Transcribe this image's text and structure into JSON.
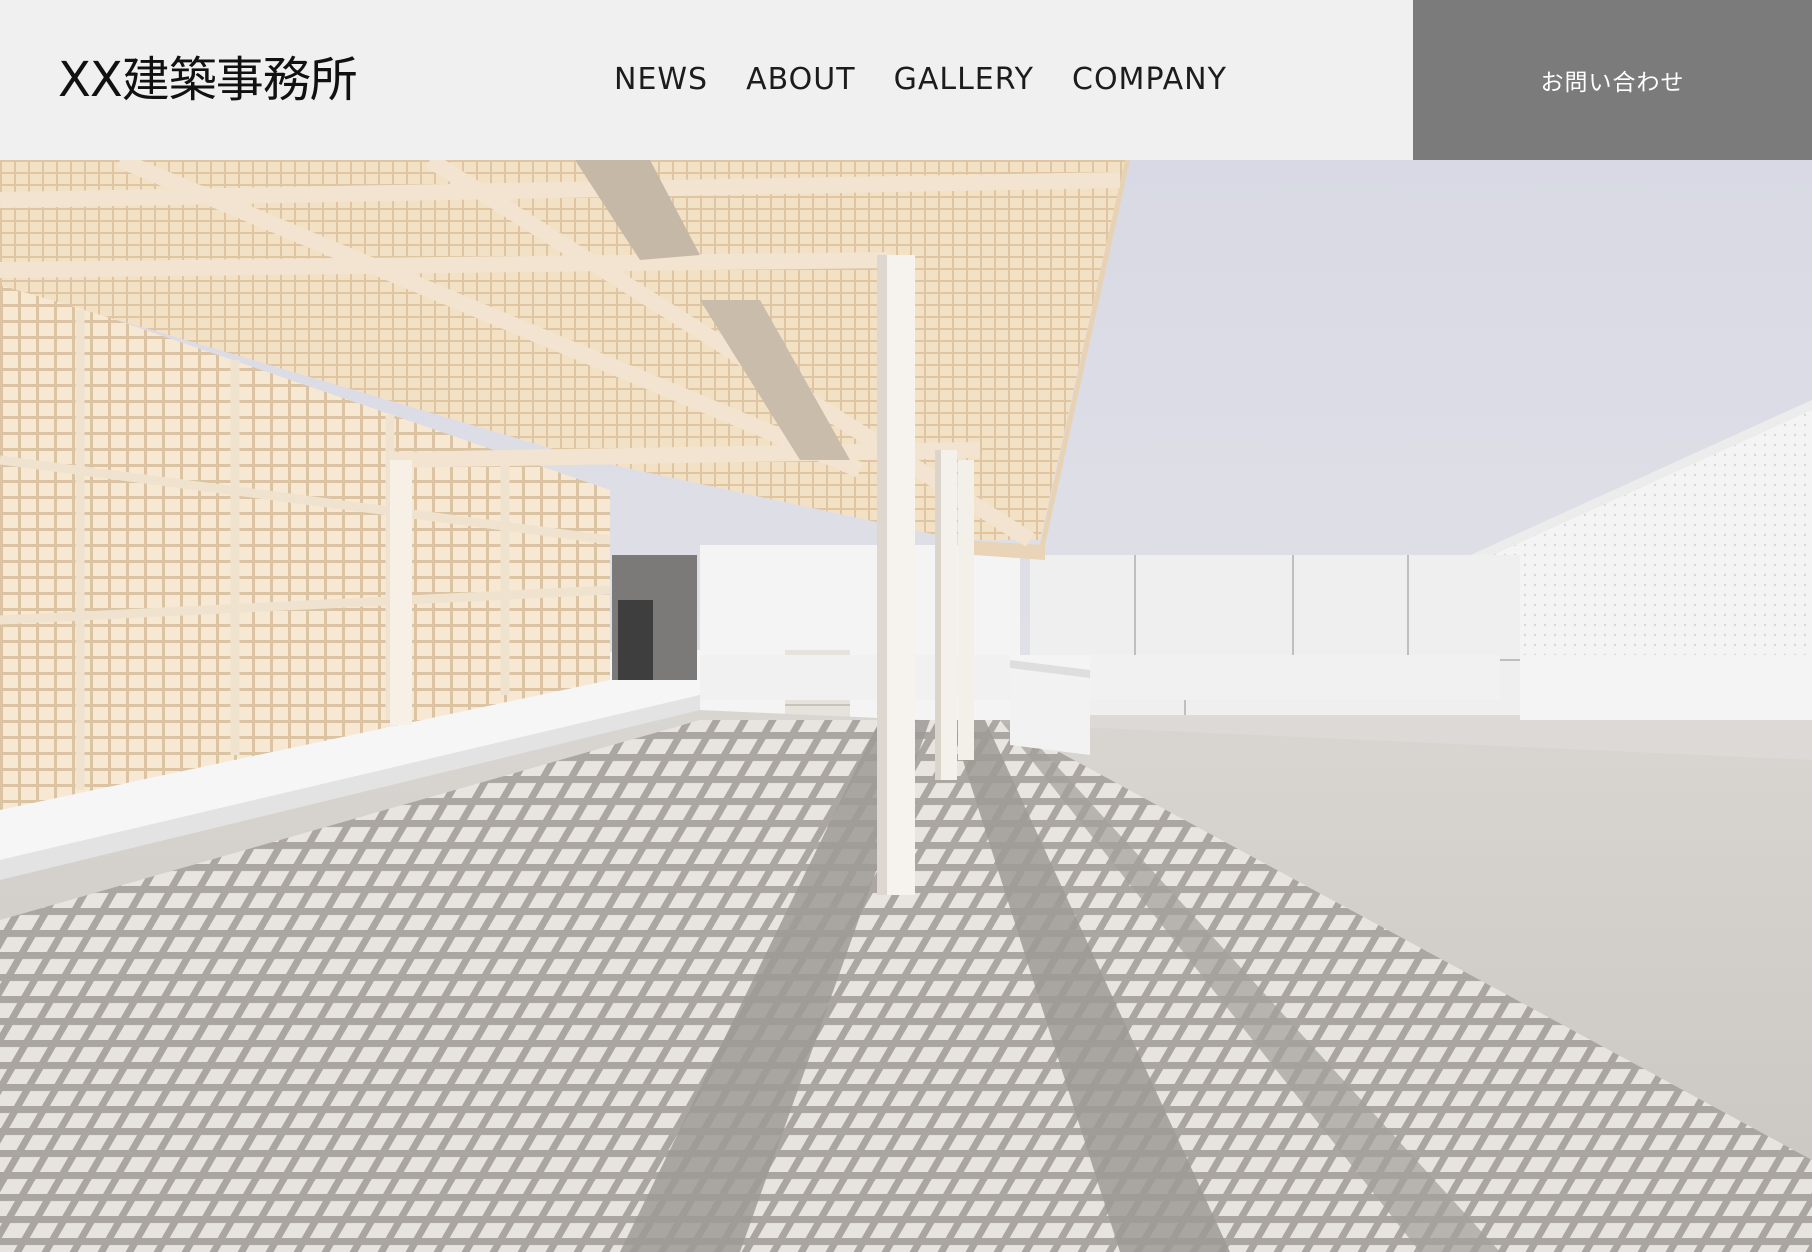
{
  "header": {
    "logo": "XX建築事務所",
    "nav": [
      {
        "label": "NEWS"
      },
      {
        "label": "ABOUT"
      },
      {
        "label": "GALLERY"
      },
      {
        "label": "COMPANY"
      }
    ],
    "contact_label": "お問い合わせ"
  },
  "hero": {
    "subject": "white latticed canopy building with grid shadows on plaza",
    "colors": {
      "sky": "#dcdde6",
      "canopy": "#efd9bd",
      "wall": "#f2f2f2",
      "floor": "#cfccc7",
      "shadow": "#9f9c99"
    }
  },
  "colors": {
    "header_bg": "#f0f0f0",
    "contact_bg": "#7b7b7b",
    "nav_text": "#1c1c1c"
  }
}
